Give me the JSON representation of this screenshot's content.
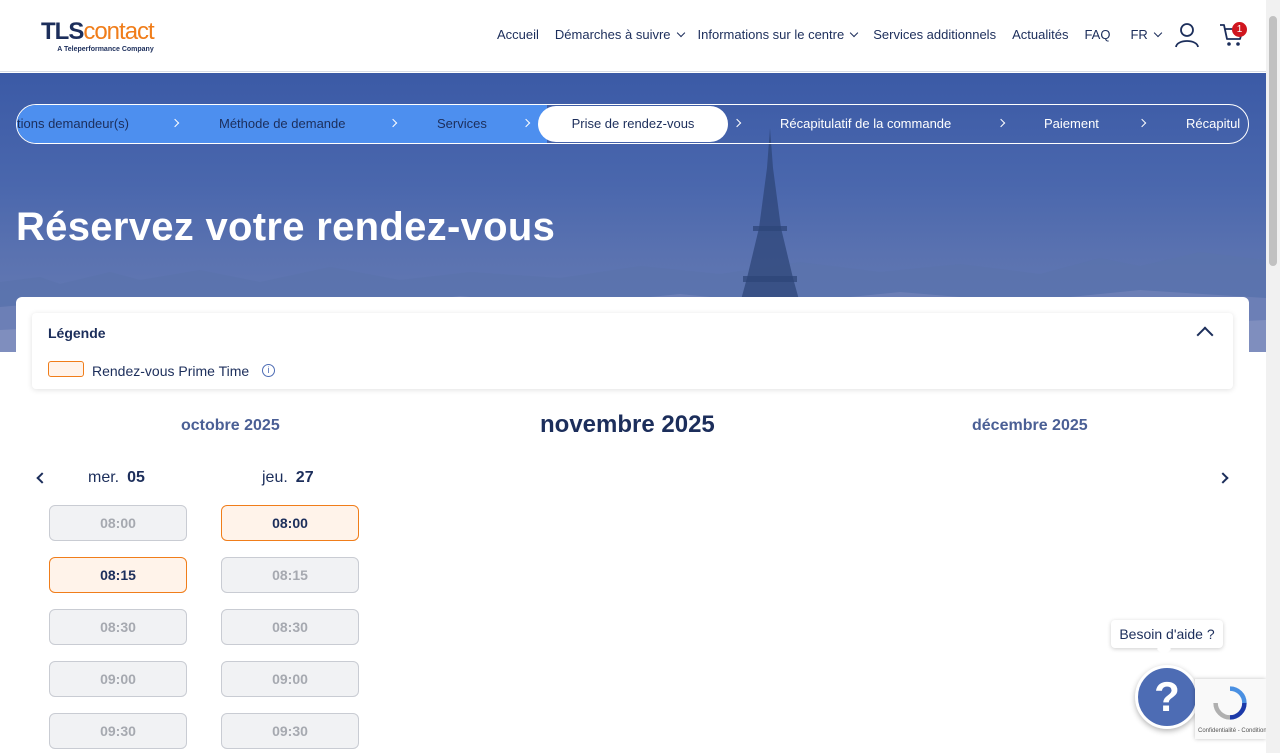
{
  "header": {
    "logo_main_1": "TLS",
    "logo_main_2": "contact",
    "logo_sub": "A Teleperformance Company",
    "nav": [
      {
        "label": "Accueil",
        "has_dropdown": false
      },
      {
        "label": "Démarches à suivre",
        "has_dropdown": true
      },
      {
        "label": "Informations sur le centre",
        "has_dropdown": true
      },
      {
        "label": "Services additionnels",
        "has_dropdown": false
      },
      {
        "label": "Actualités",
        "has_dropdown": false
      },
      {
        "label": "FAQ",
        "has_dropdown": false
      },
      {
        "label": "FR",
        "has_dropdown": true
      }
    ],
    "cart_count": "1"
  },
  "stepper": {
    "steps": [
      {
        "label": "tions demandeur(s)",
        "state": "done"
      },
      {
        "label": "Méthode de demande",
        "state": "done"
      },
      {
        "label": "Services",
        "state": "done"
      },
      {
        "label": "Prise de rendez-vous",
        "state": "active"
      },
      {
        "label": "Récapitulatif de la commande",
        "state": "future"
      },
      {
        "label": "Paiement",
        "state": "future"
      },
      {
        "label": "Récapitul",
        "state": "future"
      }
    ]
  },
  "hero": {
    "title": "Réservez votre rendez-vous"
  },
  "legend": {
    "title": "Légende",
    "item_label": "Rendez-vous Prime Time",
    "info_icon": "i"
  },
  "calendar": {
    "month_prev": "octobre 2025",
    "month_current": "novembre 2025",
    "month_next": "décembre 2025",
    "days": [
      {
        "weekday": "mer.",
        "date": "05",
        "slots": [
          {
            "time": "08:00",
            "state": "disabled"
          },
          {
            "time": "08:15",
            "state": "prime"
          },
          {
            "time": "08:30",
            "state": "disabled"
          },
          {
            "time": "09:00",
            "state": "disabled"
          },
          {
            "time": "09:30",
            "state": "disabled"
          }
        ]
      },
      {
        "weekday": "jeu.",
        "date": "27",
        "slots": [
          {
            "time": "08:00",
            "state": "prime"
          },
          {
            "time": "08:15",
            "state": "disabled"
          },
          {
            "time": "08:30",
            "state": "disabled"
          },
          {
            "time": "09:00",
            "state": "disabled"
          },
          {
            "time": "09:30",
            "state": "disabled"
          }
        ]
      }
    ]
  },
  "help": {
    "label": "Besoin d'aide ?",
    "icon": "?"
  },
  "recaptcha": {
    "text": "Confidentialité - Conditions"
  },
  "colors": {
    "brand_navy": "#1c2e5b",
    "brand_orange": "#f07d1a",
    "stepper_done": "#4d8fef",
    "badge_red": "#d0161f"
  }
}
